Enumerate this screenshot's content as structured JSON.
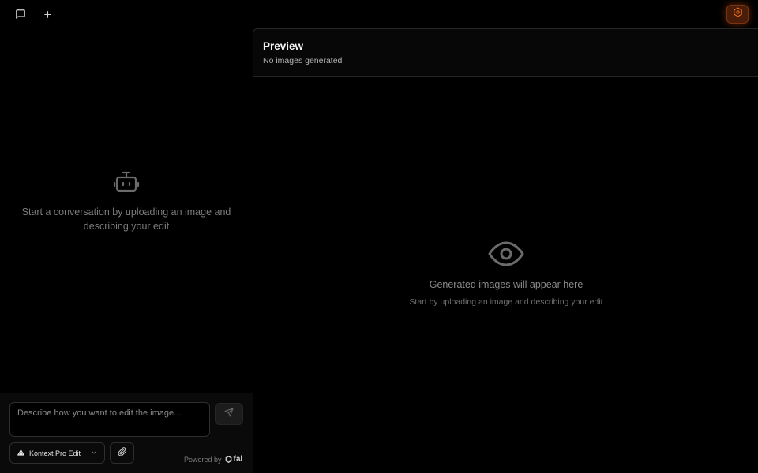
{
  "toolbar": {
    "chat_icon": "message-square-icon",
    "new_icon": "plus-icon",
    "settings_icon": "settings-hexagon-icon"
  },
  "chat": {
    "empty_icon": "bot-icon",
    "empty_text": "Start a conversation by uploading an image and describing your edit"
  },
  "composer": {
    "placeholder": "Describe how you want to edit the image...",
    "value": "",
    "send_icon": "send-icon",
    "model_label": "Kontext Pro Edit",
    "model_icon": "triangle-logo-icon",
    "attach_icon": "paperclip-icon",
    "powered_by": "Powered by",
    "brand": "fal"
  },
  "preview": {
    "title": "Preview",
    "subtitle": "No images generated",
    "empty_icon": "eye-icon",
    "empty_title": "Generated images will appear here",
    "empty_hint": "Start by uploading an image and describing your edit"
  },
  "colors": {
    "background": "#000000",
    "accent": "#ea580c",
    "muted_text": "#7c7c7c",
    "border": "#262626"
  }
}
